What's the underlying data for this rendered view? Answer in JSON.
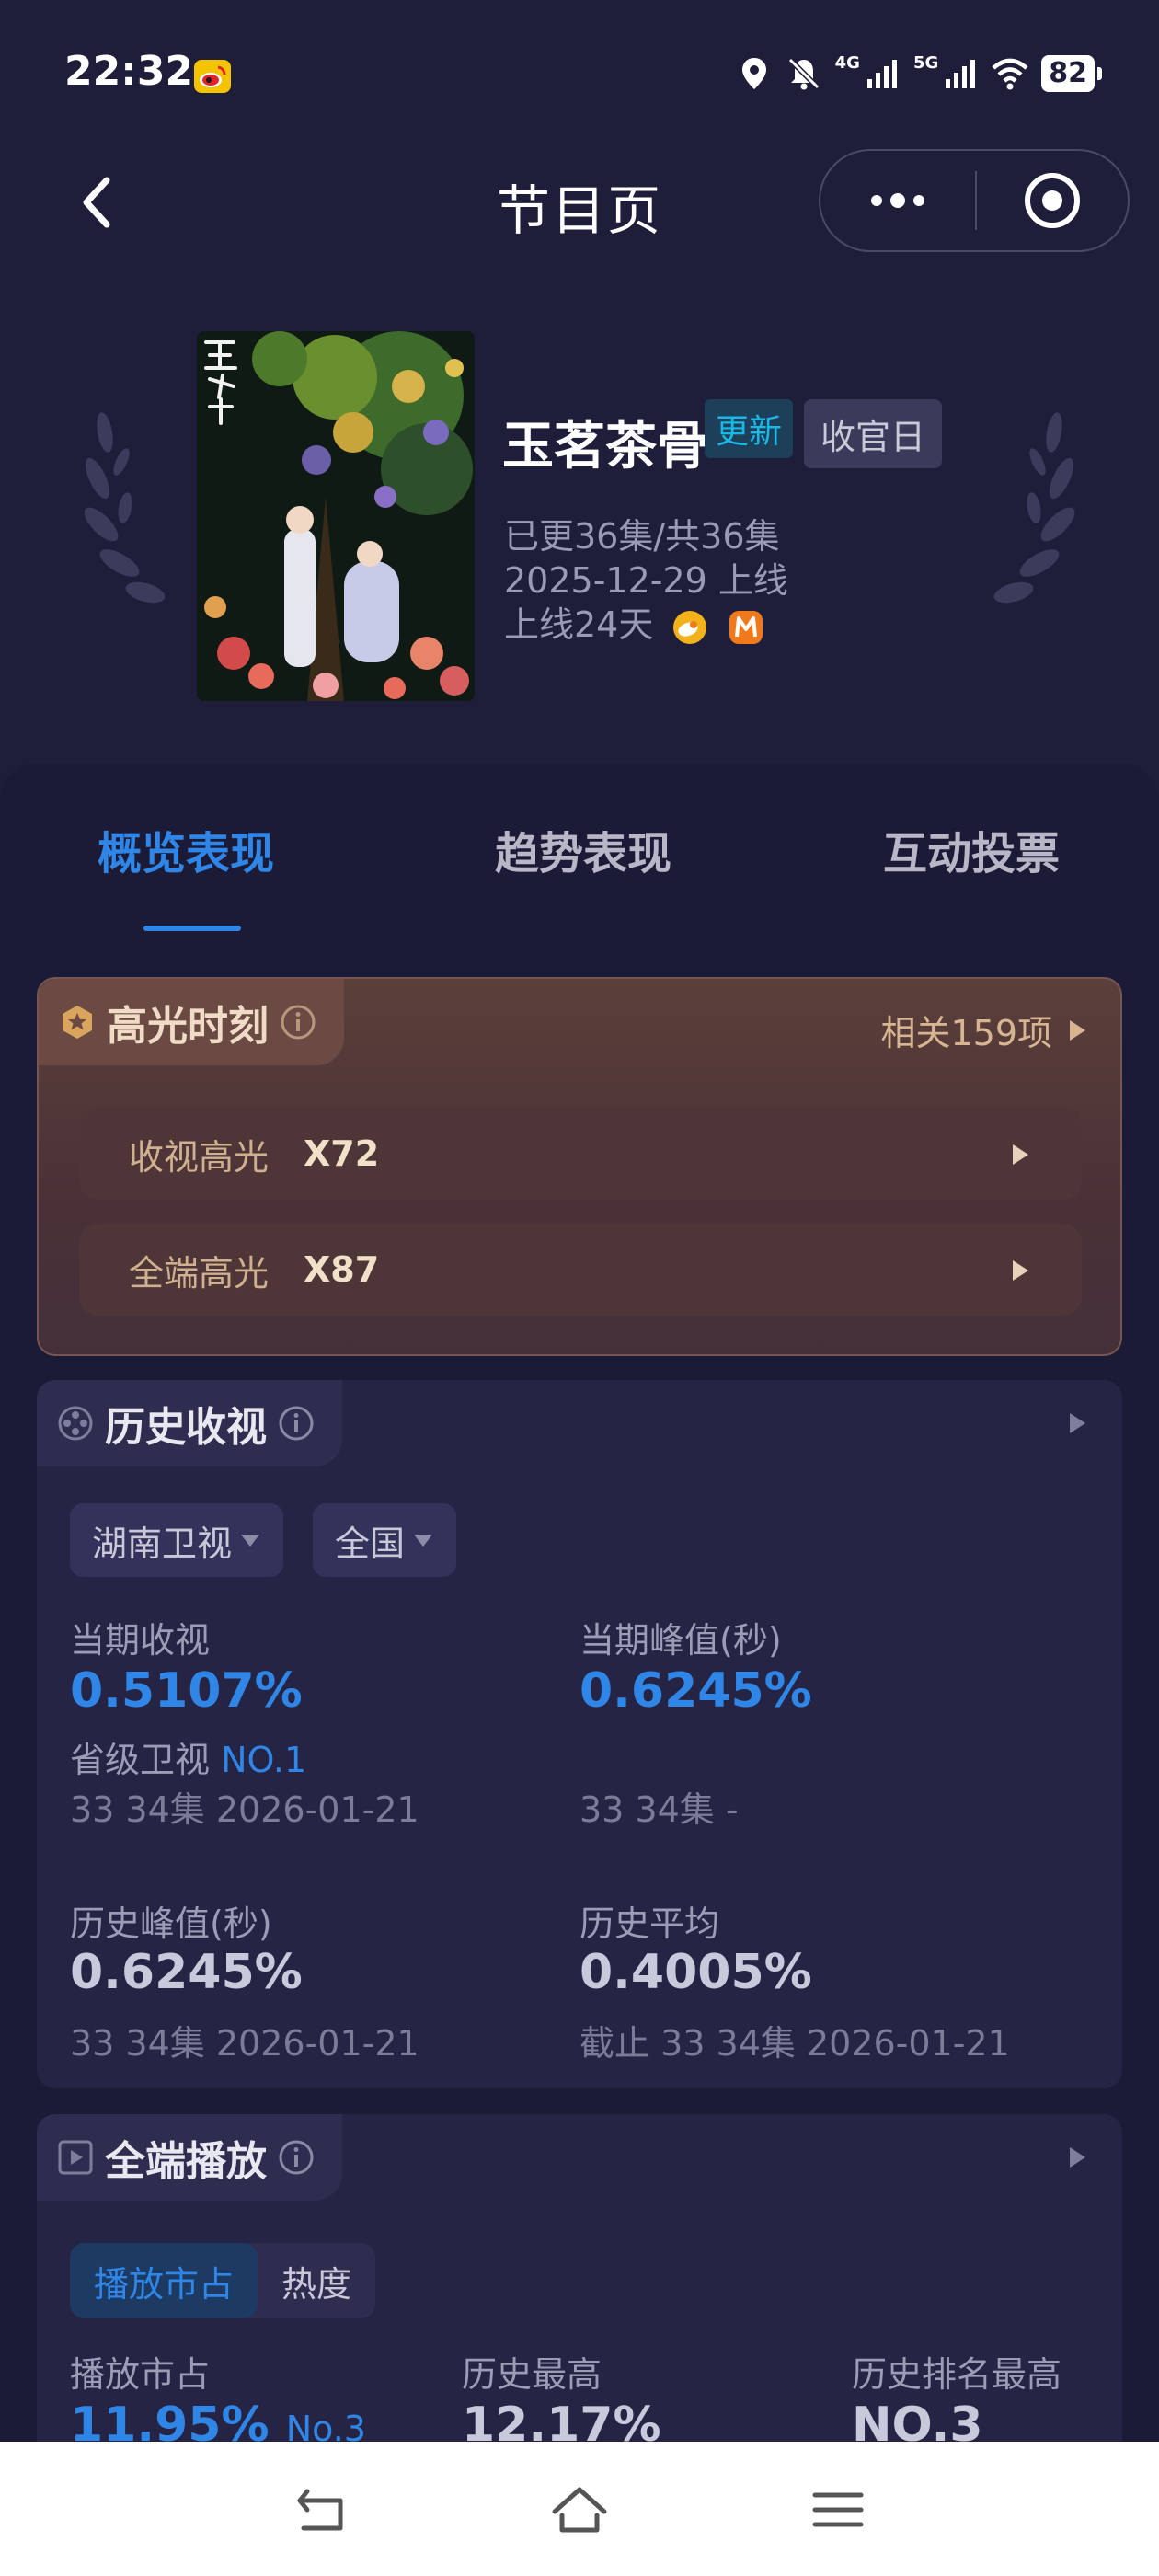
{
  "status_bar": {
    "time": "22:32",
    "net1": "4G",
    "net2": "5G",
    "battery": "82",
    "icons": [
      "weibo-icon",
      "location-icon",
      "mute-bell-icon",
      "signal-icon",
      "wifi-icon",
      "battery-icon"
    ]
  },
  "nav": {
    "title": "节目页",
    "icons": [
      "back-icon",
      "more-icon",
      "close-target-icon"
    ]
  },
  "show": {
    "title": "玉茗茶骨",
    "tag_update": "更新",
    "tag_final": "收官日",
    "episodes": "已更36集/共36集",
    "release": "2025-12-29 上线",
    "days_online": "上线24天",
    "platform_icons": [
      "mango-tv-icon",
      "hunan-tv-icon"
    ]
  },
  "tabs": [
    {
      "label": "概览表现",
      "active": true
    },
    {
      "label": "趋势表现",
      "active": false
    },
    {
      "label": "互动投票",
      "active": false
    }
  ],
  "highlight": {
    "title": "高光时刻",
    "more": "相关159项",
    "rows": [
      {
        "label": "收视高光",
        "value": "X72"
      },
      {
        "label": "全端高光",
        "value": "X87"
      }
    ]
  },
  "ratings": {
    "title": "历史收视",
    "channel": "湖南卫视",
    "region": "全国",
    "current": {
      "label": "当期收视",
      "value": "0.5107%",
      "rank_prefix": "省级卫视",
      "rank": "NO.1",
      "sub": "33 34集 2026-01-21"
    },
    "current_peak": {
      "label": "当期峰值(秒)",
      "value": "0.6245%",
      "sub": "33 34集 -"
    },
    "history_peak": {
      "label": "历史峰值(秒)",
      "value": "0.6245%",
      "sub": "33 34集 2026-01-21"
    },
    "history_avg": {
      "label": "历史平均",
      "value": "0.4005%",
      "sub": "截止 33 34集 2026-01-21"
    }
  },
  "playback": {
    "title": "全端播放",
    "seg_active": "播放市占",
    "seg_other": "热度",
    "col1_label": "播放市占",
    "col1_value": "11.95%",
    "col1_rank": "No.3",
    "col2_label": "历史最高",
    "col2_value": "12.17%",
    "col3_label": "历史排名最高",
    "col3_value": "NO.3"
  },
  "bottom_nav": [
    "back-gesture-icon",
    "home-icon",
    "menu-icon"
  ]
}
